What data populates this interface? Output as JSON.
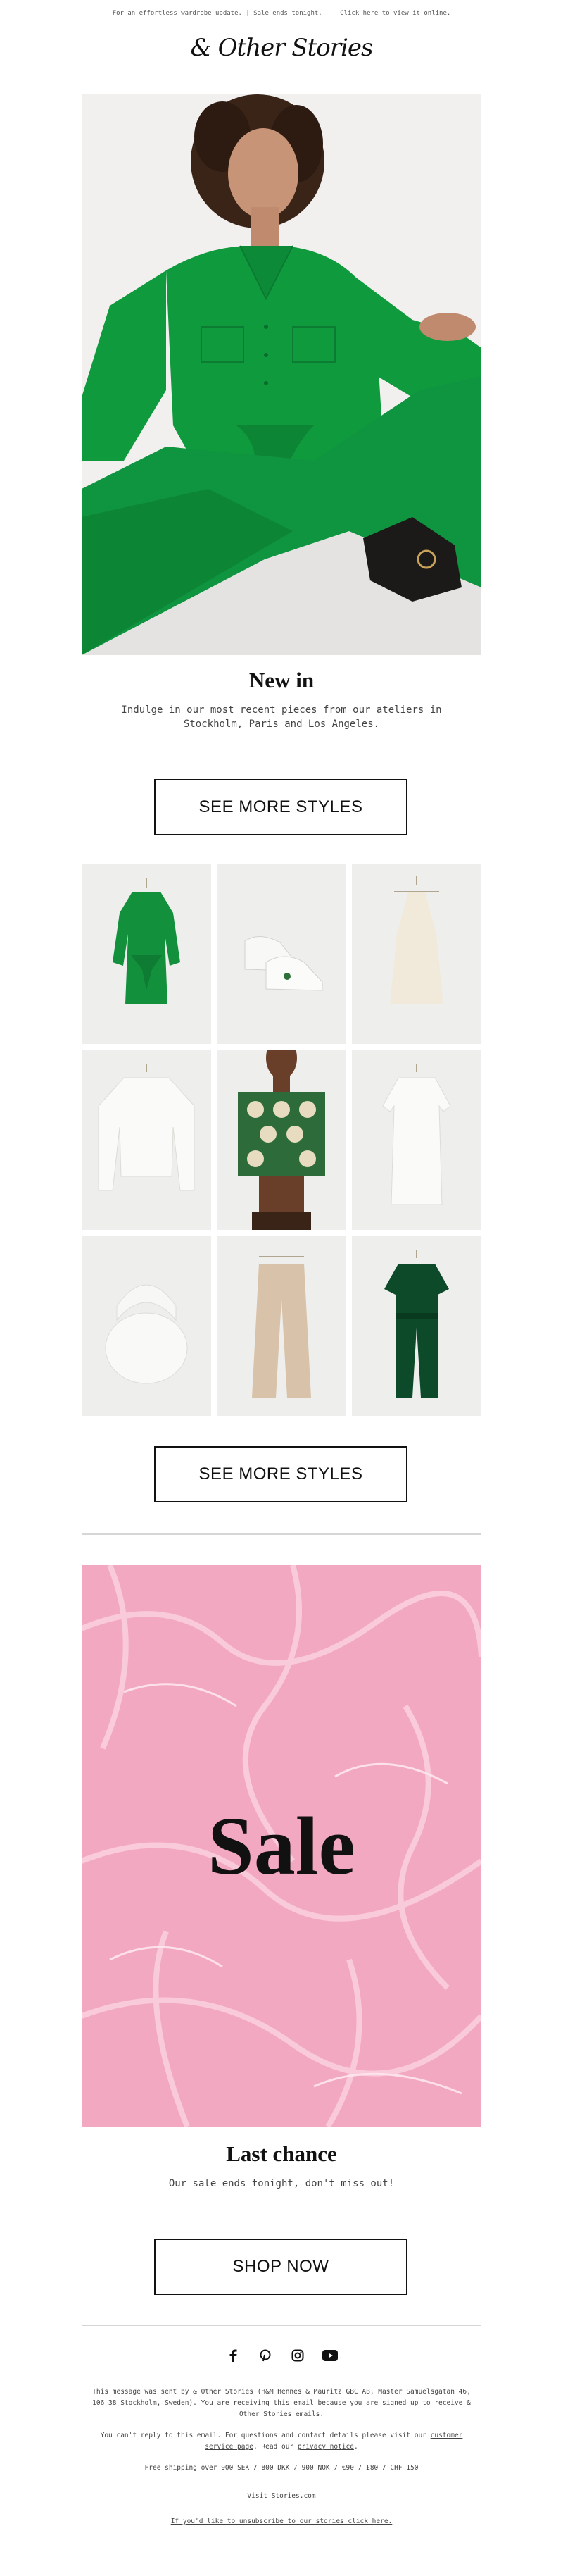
{
  "preheader": {
    "message": "For an effortless wardrobe update. | Sale ends tonight.",
    "separator": "|",
    "view_online": "Click here to view it online."
  },
  "brand": {
    "logo_text": "& Other Stories"
  },
  "new_in": {
    "title": "New in",
    "description_line1": "Indulge in our most recent pieces from our ateliers in",
    "description_line2": "Stockholm, Paris and Los Angeles.",
    "cta_top": "SEE MORE STYLES",
    "cta_bottom": "SEE MORE STYLES"
  },
  "products": [
    {
      "name": "green-dress"
    },
    {
      "name": "white-sneakers"
    },
    {
      "name": "cream-halter-top"
    },
    {
      "name": "white-blouse"
    },
    {
      "name": "printed-top"
    },
    {
      "name": "white-wrap-dress"
    },
    {
      "name": "white-bag"
    },
    {
      "name": "beige-trousers"
    },
    {
      "name": "green-jumpsuit"
    }
  ],
  "sale": {
    "banner_text": "Sale",
    "title": "Last chance",
    "description": "Our sale ends tonight, don't miss out!",
    "cta": "SHOP NOW"
  },
  "social": [
    "facebook-icon",
    "pinterest-icon",
    "instagram-icon",
    "youtube-icon"
  ],
  "footer": {
    "sender_line1": "This message was sent by & Other Stories (H&M Hennes & Mauritz GBC AB, Master Samuelsgatan 46,",
    "sender_line2": "106 38 Stockholm, Sweden). You are receiving this email because you are signed up to receive &",
    "sender_line3": "Other Stories emails.",
    "reply_line1_a": "You can't reply to this email. For questions and contact details please visit our",
    "reply_link1": "customer",
    "reply_link2": "service page",
    "reply_line2_b": ". Read our",
    "privacy_link": "privacy notice",
    "reply_end": ".",
    "shipping": "Free shipping over 900 SEK / 800 DKK / 900 NOK / €90 / £80 / CHF 150",
    "visit": "Visit Stories.com",
    "unsubscribe": "If you'd like to unsubscribe to our stories click here."
  },
  "colors": {
    "accent_green": "#109a3e",
    "sale_pink": "#f3a8c1",
    "text_dark": "#111111"
  }
}
